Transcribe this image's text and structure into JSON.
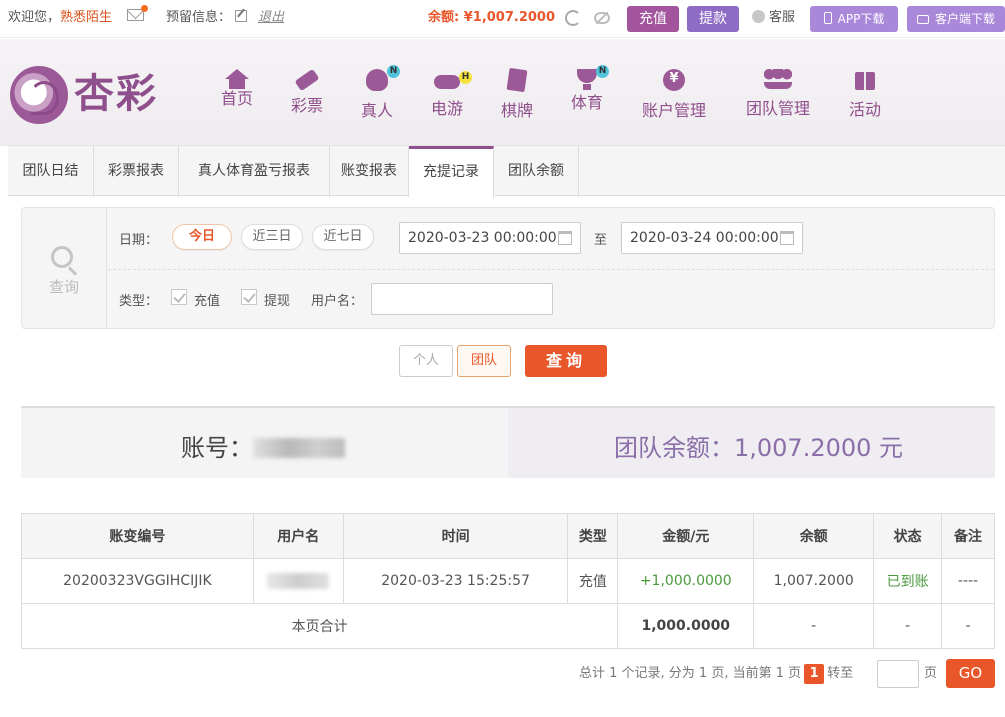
{
  "topbar": {
    "welcome": "欢迎您，",
    "username": "熟悉陌生",
    "reserve_label": "预留信息：",
    "logout": "退出",
    "balance": "余额: ¥1,007.2000",
    "recharge": "充值",
    "withdraw": "提款",
    "service": "客服",
    "app_download": "APP下载",
    "client_download": "客户端下载"
  },
  "header": {
    "brand": "杏彩",
    "nav": [
      {
        "label": "首页",
        "icon": "home-icon"
      },
      {
        "label": "彩票",
        "icon": "ticket-icon"
      },
      {
        "label": "真人",
        "icon": "dealer-icon",
        "badge": "N"
      },
      {
        "label": "电游",
        "icon": "gamepad-icon",
        "badge": "H"
      },
      {
        "label": "棋牌",
        "icon": "cards-icon"
      },
      {
        "label": "体育",
        "icon": "trophy-icon",
        "badge": "N"
      },
      {
        "label": "账户管理",
        "icon": "coin-icon"
      },
      {
        "label": "团队管理",
        "icon": "team-icon"
      },
      {
        "label": "活动",
        "icon": "gift-icon"
      }
    ]
  },
  "tabs": [
    "团队日结",
    "彩票报表",
    "真人体育盈亏报表",
    "账变报表",
    "充提记录",
    "团队余额"
  ],
  "active_tab": "充提记录",
  "query": {
    "side_label": "查询",
    "date_label": "日期：",
    "quick_dates": [
      "今日",
      "近三日",
      "近七日"
    ],
    "start_date": "2020-03-23 00:00:00",
    "to": "至",
    "end_date": "2020-03-24 00:00:00",
    "type_label": "类型：",
    "type_recharge": "充值",
    "type_withdraw": "提现",
    "username_label": "用户名：",
    "username_value": "",
    "mode_personal": "个人",
    "mode_team": "团队",
    "search": "查询"
  },
  "summary": {
    "account_label": "账号：",
    "team_balance": "团队余额：1,007.2000 元"
  },
  "table": {
    "headers": [
      "账变编号",
      "用户名",
      "时间",
      "类型",
      "金额/元",
      "余额",
      "状态",
      "备注"
    ],
    "rows": [
      {
        "id": "20200323VGGIHCIJIK",
        "time": "2020-03-23 15:25:57",
        "type": "充值",
        "amount": "+1,000.0000",
        "balance": "1,007.2000",
        "status": "已到账",
        "note": "----"
      }
    ],
    "footer": {
      "label": "本页合计",
      "amount": "1,000.0000",
      "balance": "-",
      "status": "-",
      "note": "-"
    }
  },
  "pager": {
    "summary": "总计 1 个记录, 分为 1 页, 当前第 1 页",
    "current": "1",
    "goto": "转至",
    "page": "页",
    "go": "GO"
  }
}
